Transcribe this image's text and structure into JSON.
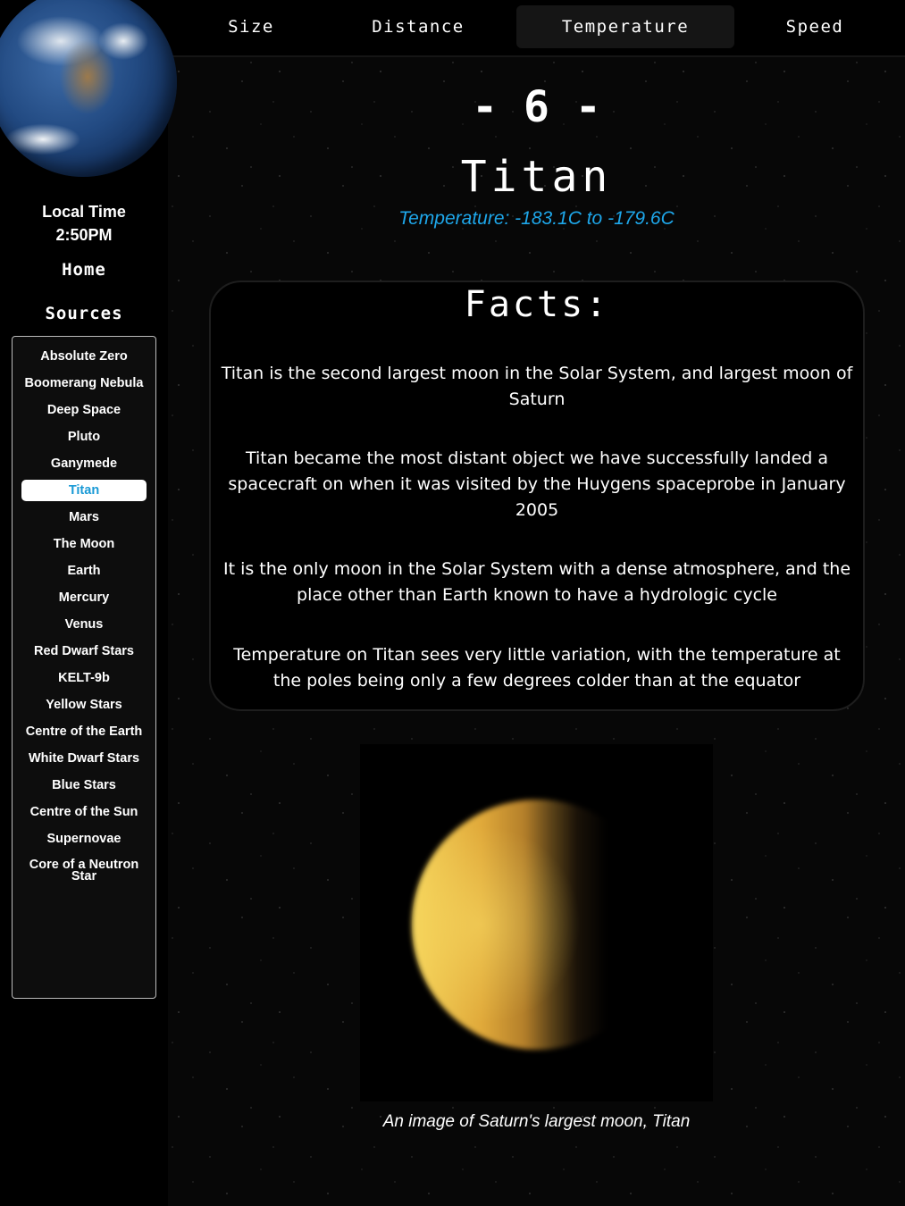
{
  "nav": {
    "tabs": [
      {
        "label": "Size"
      },
      {
        "label": "Distance"
      },
      {
        "label": "Temperature",
        "active": true
      },
      {
        "label": "Speed"
      }
    ]
  },
  "sidebar": {
    "local_time_label": "Local Time",
    "local_time_value": "2:50PM",
    "home_label": "Home",
    "sources_label": "Sources",
    "items": [
      {
        "label": "Absolute Zero"
      },
      {
        "label": "Boomerang Nebula"
      },
      {
        "label": "Deep Space"
      },
      {
        "label": "Pluto"
      },
      {
        "label": "Ganymede"
      },
      {
        "label": "Titan",
        "active": true
      },
      {
        "label": "Mars"
      },
      {
        "label": "The Moon"
      },
      {
        "label": "Earth"
      },
      {
        "label": "Mercury"
      },
      {
        "label": "Venus"
      },
      {
        "label": "Red Dwarf Stars"
      },
      {
        "label": "KELT-9b"
      },
      {
        "label": "Yellow Stars"
      },
      {
        "label": "Centre of the Earth"
      },
      {
        "label": "White Dwarf Stars"
      },
      {
        "label": "Blue Stars"
      },
      {
        "label": "Centre of the Sun"
      },
      {
        "label": "Supernovae"
      },
      {
        "label": "Core of a Neutron Star"
      }
    ]
  },
  "page": {
    "rank": "- 6 -",
    "title": "Titan",
    "temperature": "Temperature: -183.1C to -179.6C",
    "accent_color": "#1ea7ea"
  },
  "facts": {
    "heading": "Facts:",
    "items": [
      "Titan is the second largest moon in the Solar System, and largest moon of Saturn",
      "Titan became the most distant object we have successfully landed a spacecraft on when it was visited by the Huygens spaceprobe in January 2005",
      "It is the only moon in the Solar System with a dense atmosphere, and the place other than Earth known to have a hydrologic cycle",
      "Temperature on Titan sees very little variation, with the temperature at the poles being only a few degrees colder than at the equator"
    ]
  },
  "image": {
    "caption": "An image of Saturn's largest moon, Titan"
  }
}
